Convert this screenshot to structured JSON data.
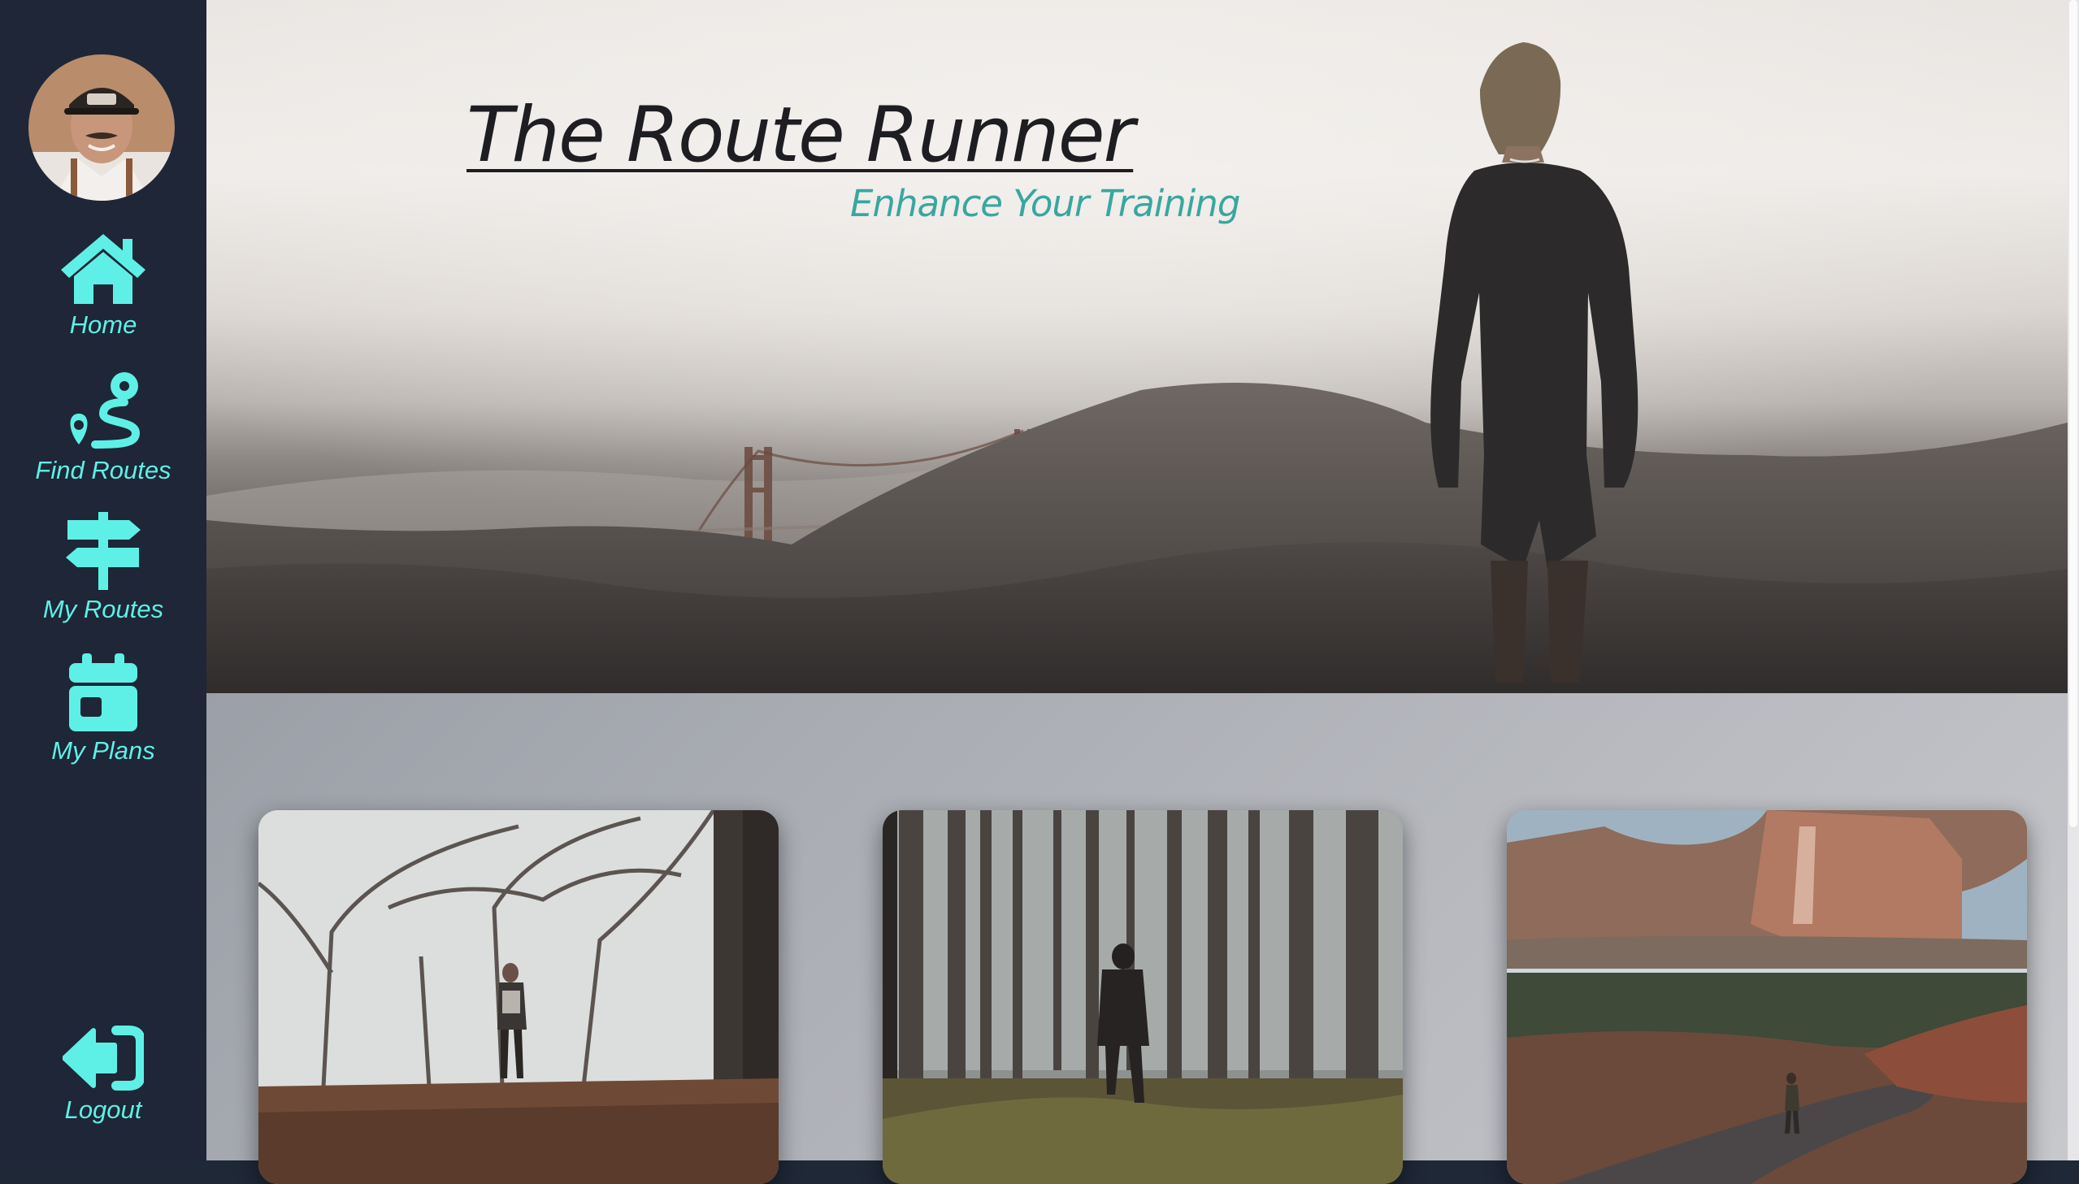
{
  "sidebar": {
    "items": [
      {
        "label": "Home",
        "icon": "home-icon"
      },
      {
        "label": "Find Routes",
        "icon": "route-icon"
      },
      {
        "label": "My Routes",
        "icon": "signpost-icon"
      },
      {
        "label": "My Plans",
        "icon": "calendar-icon"
      }
    ],
    "logout": {
      "label": "Logout",
      "icon": "logout-icon"
    }
  },
  "hero": {
    "title": "The Route Runner",
    "subtitle": "Enhance Your Training"
  },
  "cards": [
    {
      "scene": "foggy-park-runner"
    },
    {
      "scene": "forest-runner"
    },
    {
      "scene": "canyon-road-runner"
    }
  ],
  "colors": {
    "sidebar_bg": "#1e2637",
    "accent": "#5ef0e6",
    "subtitle": "#38a7a0",
    "title": "#1d1d22"
  }
}
